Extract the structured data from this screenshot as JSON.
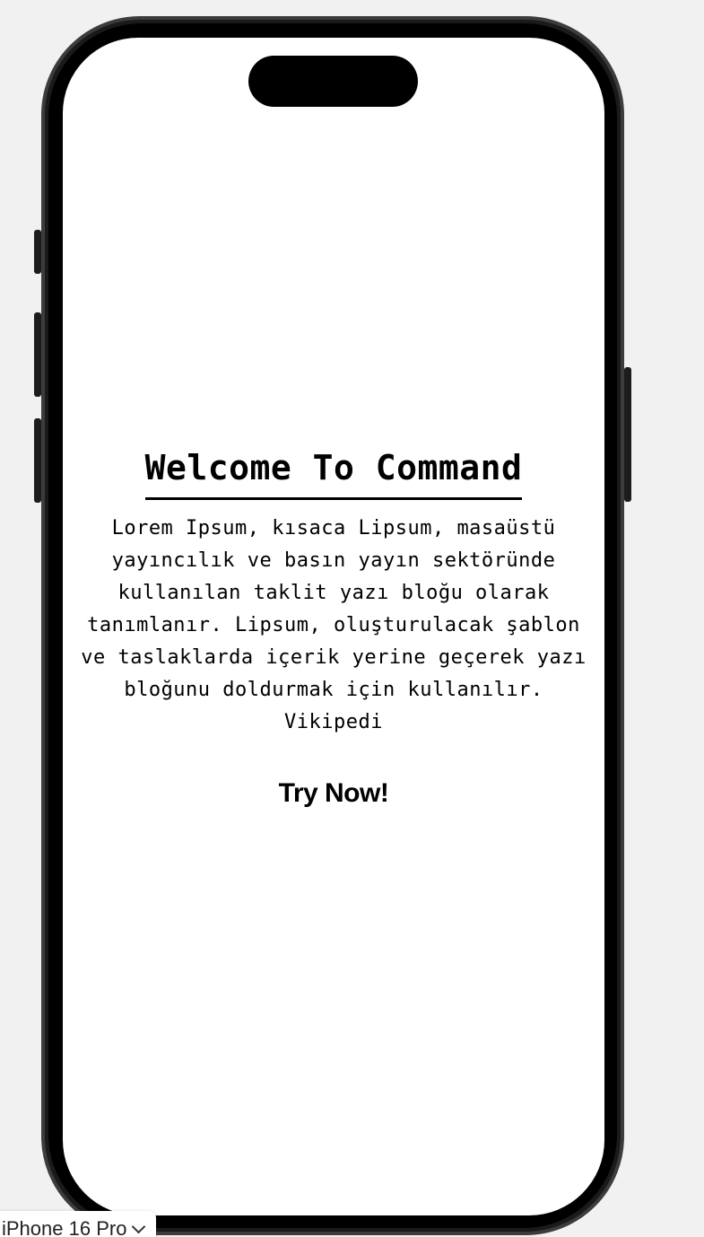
{
  "screen": {
    "title": "Welcome To Command",
    "body": "Lorem Ipsum, kısaca Lipsum, masaüstü yayıncılık ve basın yayın sektöründe kullanılan taklit yazı bloğu olarak tanımlanır. Lipsum, oluşturulacak şablon ve taslaklarda içerik yerine geçerek yazı bloğunu doldurmak için kullanılır. Vikipedi",
    "cta_label": "Try Now!"
  },
  "device_picker": {
    "selected": "iPhone 16 Pro",
    "icon": "chevron-down-icon"
  },
  "colors": {
    "background": "#f1f1f1",
    "screen": "#ffffff",
    "text": "#000000",
    "frame": "#000000"
  }
}
